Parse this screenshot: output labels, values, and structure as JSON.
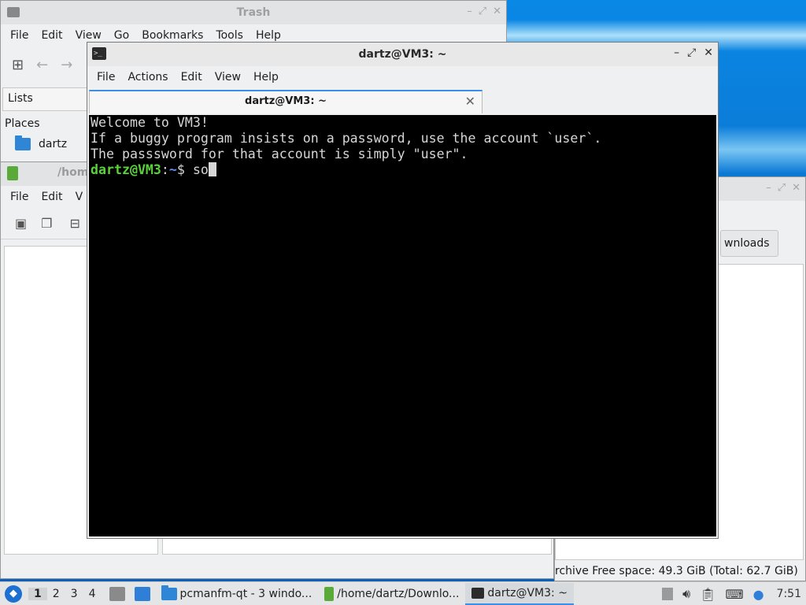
{
  "trash_window": {
    "title": "Trash",
    "menu": [
      "File",
      "Edit",
      "View",
      "Go",
      "Bookmarks",
      "Tools",
      "Help"
    ],
    "lists_label": "Lists",
    "places_label": "Places",
    "place_item": "dartz"
  },
  "downloads_window": {
    "title": "/home/dartz/Downloads",
    "title_visible": "/hom",
    "menu": [
      "File",
      "Edit",
      "V"
    ]
  },
  "right_window": {
    "downloads_button": "wnloads",
    "status_text": "rchive   Free space: 49.3 GiB (Total: 62.7 GiB)"
  },
  "terminal": {
    "title": "dartz@VM3: ~",
    "menu": [
      "File",
      "Actions",
      "Edit",
      "View",
      "Help"
    ],
    "tab_label": "dartz@VM3: ~",
    "lines": [
      "Welcome to VM3!",
      "If a buggy program insists on a password, use the account `user`.",
      "The passsword for that account is simply \"user\".",
      ""
    ],
    "prompt_user": "dartz@VM3",
    "prompt_sep": ":",
    "prompt_path": "~",
    "prompt_symbol": "$ ",
    "typed": "so"
  },
  "taskbar": {
    "workspaces": [
      "1",
      "2",
      "3",
      "4"
    ],
    "tasks": [
      {
        "label": "pcmanfm-qt - 3 windo..."
      },
      {
        "label": "/home/dartz/Downlo..."
      },
      {
        "label": "dartz@VM3: ~"
      }
    ],
    "clock": "7:51"
  },
  "colors": {
    "prompt_user": "#5ad23a",
    "prompt_path": "#5b8ff0",
    "accent": "#3d8ee6"
  }
}
